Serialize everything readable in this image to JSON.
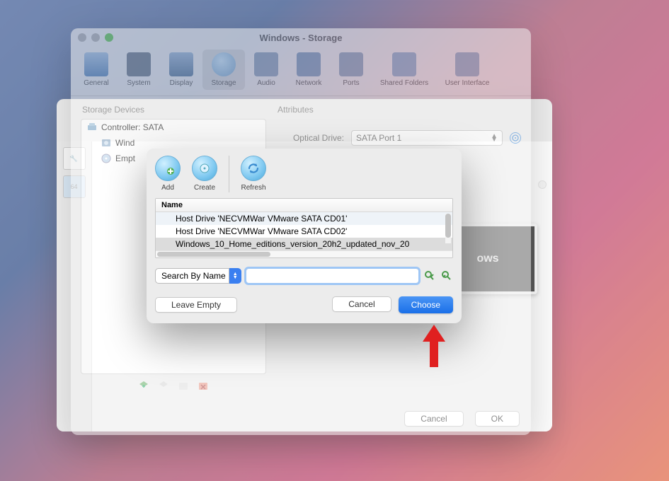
{
  "bg_app": {
    "preview_label": "ows",
    "sidebar_badge": "64"
  },
  "settings": {
    "title": "Windows - Storage",
    "toolbar": [
      {
        "label": "General"
      },
      {
        "label": "System"
      },
      {
        "label": "Display"
      },
      {
        "label": "Storage"
      },
      {
        "label": "Audio"
      },
      {
        "label": "Network"
      },
      {
        "label": "Ports"
      },
      {
        "label": "Shared Folders"
      },
      {
        "label": "User Interface"
      }
    ],
    "left_panel_label": "Storage Devices",
    "tree": {
      "controller": "Controller: SATA",
      "children": [
        {
          "label": "Windows.vdi",
          "visible": "Wind"
        },
        {
          "label": "Empty",
          "visible": "Empt"
        }
      ]
    },
    "right_panel_label": "Attributes",
    "optical_drive_label": "Optical Drive:",
    "optical_drive_value": "SATA Port 1",
    "cancel": "Cancel",
    "ok": "OK"
  },
  "chooser": {
    "toolbar": {
      "add": "Add",
      "create": "Create",
      "refresh": "Refresh"
    },
    "list_header": "Name",
    "rows": [
      "Host Drive 'NECVMWar VMware SATA CD01'",
      "Host Drive 'NECVMWar VMware SATA CD02'",
      "Windows_10_Home_editions_version_20h2_updated_nov_20"
    ],
    "search_mode": "Search By Name",
    "search_value": "",
    "leave_empty": "Leave Empty",
    "cancel": "Cancel",
    "choose": "Choose"
  }
}
